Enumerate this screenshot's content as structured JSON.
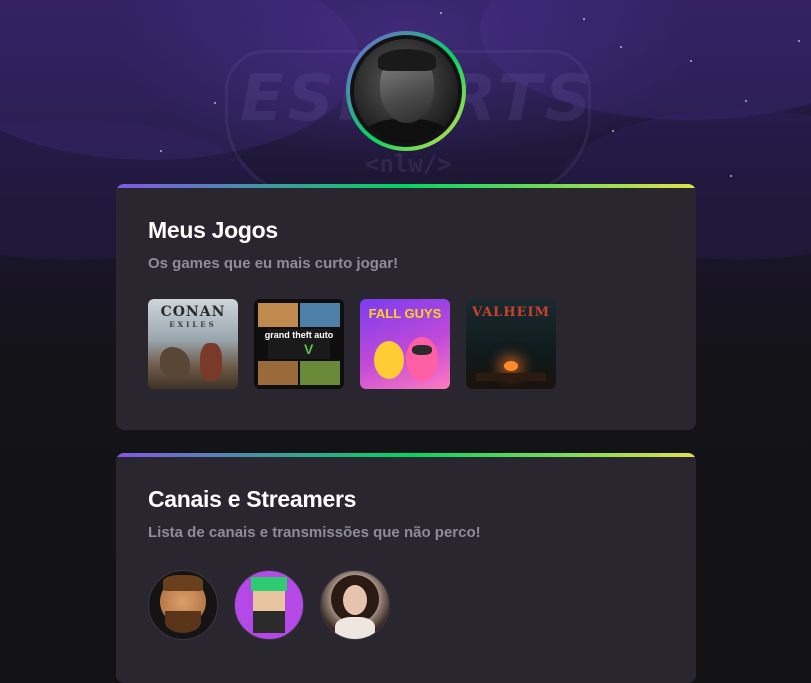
{
  "background": {
    "watermark_text": "ESPORTS",
    "watermark_subtext": "<nlw/>"
  },
  "profile": {
    "avatar_alt": "Profile photo"
  },
  "games_section": {
    "title": "Meus Jogos",
    "subtitle": "Os games que eu mais curto jogar!",
    "games": [
      {
        "name": "Conan Exiles",
        "label": "CONAN",
        "sublabel": "EXILES"
      },
      {
        "name": "Grand Theft Auto V",
        "label": "grand theft auto",
        "sublabel": "V"
      },
      {
        "name": "Fall Guys",
        "label": "FALL GUYS",
        "sublabel": ""
      },
      {
        "name": "Valheim",
        "label": "VALHEIM",
        "sublabel": ""
      }
    ]
  },
  "streamers_section": {
    "title": "Canais e Streamers",
    "subtitle": "Lista de canais e transmissões que não perco!",
    "streamers": [
      {
        "name": "Streamer 1"
      },
      {
        "name": "Streamer 2"
      },
      {
        "name": "Streamer 3"
      }
    ]
  },
  "colors": {
    "accent_purple": "#8257e5",
    "accent_green": "#04d361",
    "accent_yellow": "#e1e14b",
    "card_background": "#29262f",
    "subtitle_gray": "#8d8d99"
  }
}
